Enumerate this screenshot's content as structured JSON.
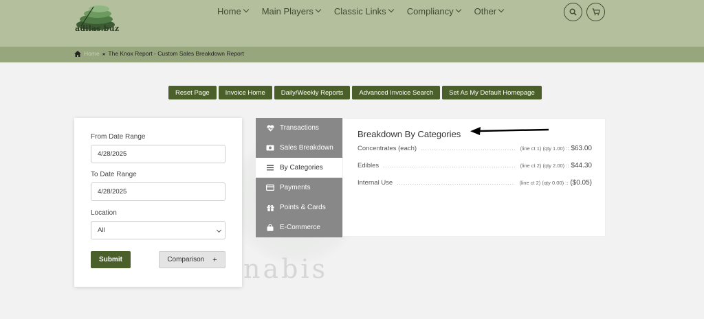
{
  "header": {
    "logo_text": "adilas.buz",
    "nav": [
      {
        "label": "Home"
      },
      {
        "label": "Main Players"
      },
      {
        "label": "Classic Links"
      },
      {
        "label": "Compliancy"
      },
      {
        "label": "Other"
      }
    ],
    "icons": {
      "search": "search-icon",
      "cart": "cart-icon"
    }
  },
  "breadcrumb": {
    "home": "Home",
    "current": "The Knox Report - Custom Sales Breakdown Report"
  },
  "actions": [
    {
      "label": "Reset Page"
    },
    {
      "label": "Invoice Home"
    },
    {
      "label": "Daily/Weekly Reports"
    },
    {
      "label": "Advanced Invoice Search"
    },
    {
      "label": "Set As My Default Homepage"
    }
  ],
  "watermark": {
    "text": "nabis"
  },
  "filters": {
    "from_label": "From Date Range",
    "from_value": "4/28/2025",
    "to_label": "To Date Range",
    "to_value": "4/28/2025",
    "location_label": "Location",
    "location_value": "All",
    "submit_label": "Submit",
    "comparison_label": "Comparison",
    "comparison_plus": "+"
  },
  "menu": [
    {
      "label": "Transactions",
      "icon": "heart-pulse-icon"
    },
    {
      "label": "Sales Breakdown",
      "icon": "money-icon"
    },
    {
      "label": "By Categories",
      "icon": "list-icon"
    },
    {
      "label": "Payments",
      "icon": "credit-card-icon"
    },
    {
      "label": "Points & Cards",
      "icon": "gift-icon"
    },
    {
      "label": "E-Commerce",
      "icon": "shopping-bag-icon"
    }
  ],
  "breakdown": {
    "title": "Breakdown By Categories",
    "rows": [
      {
        "name": "Concentrates (each)",
        "meta": "(line ct 1) (qty 1.00) ::",
        "amount": "$63.00"
      },
      {
        "name": "Edibles",
        "meta": "(line ct 2) (qty 2.00) ::",
        "amount": "$44.30"
      },
      {
        "name": "Internal Use",
        "meta": "(line ct 2) (qty 0.00) ::",
        "amount": "($0.05)"
      }
    ]
  },
  "colors": {
    "header_bg": "#b3bf9d",
    "breadcrumb_bg": "#98a67e",
    "button_green": "#4b5f2b",
    "menu_gray": "#888888"
  }
}
